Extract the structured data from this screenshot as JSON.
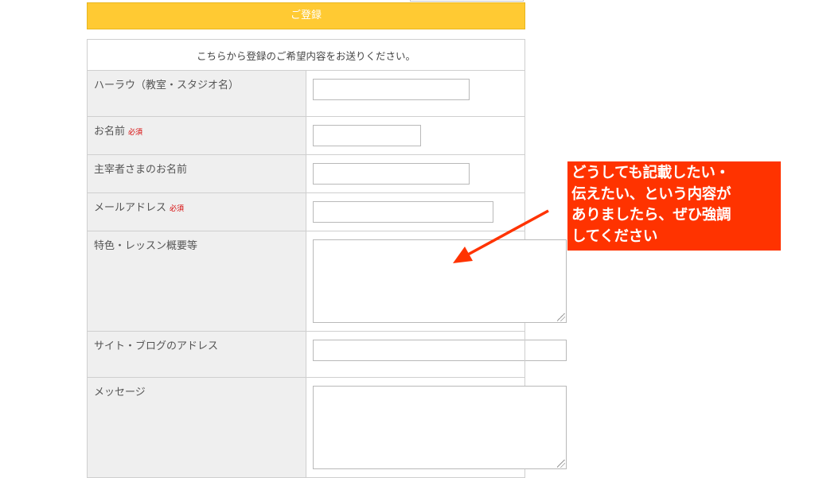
{
  "header": {
    "title": "ご登録"
  },
  "form": {
    "intro": "こちらから登録のご希望内容をお送りください。",
    "required_label": "必須",
    "fields": [
      {
        "label": "ハーラウ（教室・スタジオ名）",
        "required": false,
        "value": ""
      },
      {
        "label": "お名前",
        "required": true,
        "value": ""
      },
      {
        "label": "主宰者さまのお名前",
        "required": false,
        "value": ""
      },
      {
        "label": "メールアドレス",
        "required": true,
        "value": ""
      },
      {
        "label": "特色・レッスン概要等",
        "required": false,
        "value": ""
      },
      {
        "label": "サイト・ブログのアドレス",
        "required": false,
        "value": ""
      },
      {
        "label": "メッセージ",
        "required": false,
        "value": ""
      }
    ]
  },
  "callout": {
    "lines": [
      "どうしても記載したい・",
      "伝えたい、という内容が",
      "ありましたら、ぜひ強調",
      "してください"
    ],
    "background": "#ff3300"
  },
  "colors": {
    "header_bg": "#ffca33",
    "label_bg": "#efefef",
    "required": "#d60000",
    "arrow": "#ff3300"
  }
}
